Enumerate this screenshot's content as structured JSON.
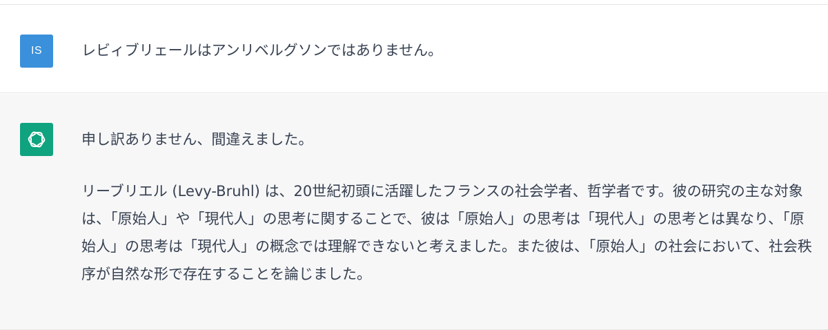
{
  "conversation": {
    "user_message": {
      "avatar_initials": "IS",
      "avatar_color": "#3a90db",
      "text": "レビィブリェールはアンリベルグソンではありません。"
    },
    "assistant_message": {
      "avatar_icon": "openai-logo-icon",
      "avatar_color": "#10a37f",
      "paragraph_1": "申し訳ありません、間違えました。",
      "paragraph_2": "リーブリエル (Levy-Bruhl) は、20世紀初頭に活躍したフランスの社会学者、哲学者です。彼の研究の主な対象は、「原始人」や「現代人」の思考に関することで、彼は「原始人」の思考は「現代人」の思考とは異なり、「原始人」の思考は「現代人」の概念では理解できないと考えました。また彼は、「原始人」の社会において、社会秩序が自然な形で存在することを論じました。"
    }
  }
}
